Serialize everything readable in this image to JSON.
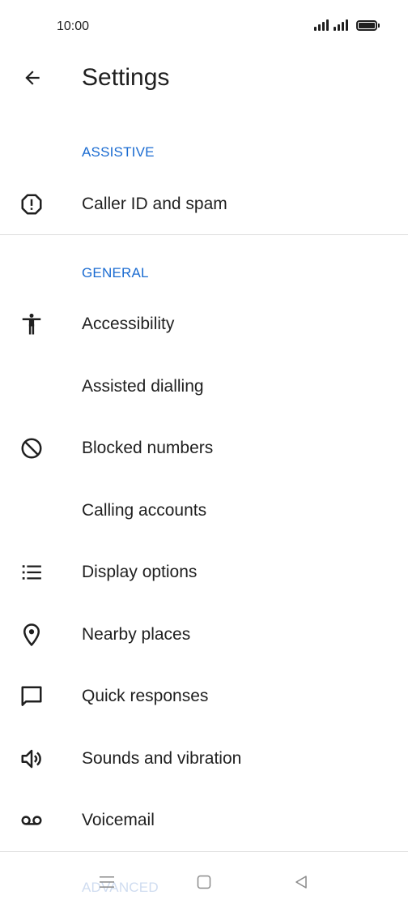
{
  "status_bar": {
    "time": "10:00"
  },
  "app_bar": {
    "title": "Settings",
    "back_icon": "arrow-back-icon"
  },
  "sections": [
    {
      "header": "ASSISTIVE",
      "items": [
        {
          "label": "Caller ID and spam",
          "icon": "caller-id-spam-icon"
        }
      ]
    },
    {
      "header": "GENERAL",
      "items": [
        {
          "label": "Accessibility",
          "icon": "accessibility-icon"
        },
        {
          "label": "Assisted dialling",
          "icon": ""
        },
        {
          "label": "Blocked numbers",
          "icon": "block-icon"
        },
        {
          "label": "Calling accounts",
          "icon": ""
        },
        {
          "label": "Display options",
          "icon": "list-icon"
        },
        {
          "label": "Nearby places",
          "icon": "location-pin-icon"
        },
        {
          "label": "Quick responses",
          "icon": "chat-bubble-icon"
        },
        {
          "label": "Sounds and vibration",
          "icon": "volume-icon"
        },
        {
          "label": "Voicemail",
          "icon": "voicemail-icon"
        }
      ]
    },
    {
      "header": "ADVANCED",
      "items": []
    }
  ],
  "nav_bar": {
    "menu_icon": "menu-icon",
    "home_icon": "home-icon",
    "back_icon": "nav-back-icon"
  },
  "colors": {
    "accent": "#1a6bd1",
    "text": "#1f1f1f",
    "divider": "#dedede"
  }
}
